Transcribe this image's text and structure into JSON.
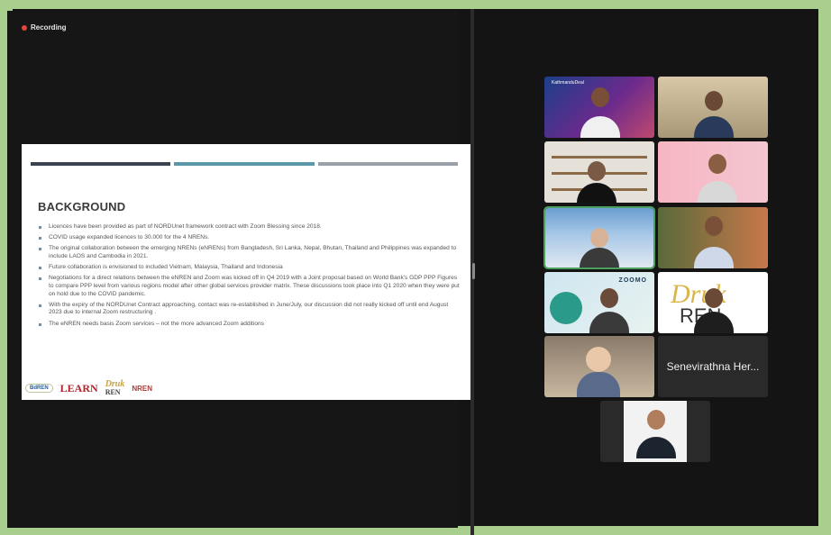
{
  "recording": {
    "label": "Recording"
  },
  "slide": {
    "title": "BACKGROUND",
    "bar_colors": [
      "#3b4350",
      "#5a98a8",
      "#9aa0a8"
    ],
    "bullets": [
      "Licences have been provided as part of NORDUnet framework contract with Zoom Blessing since 2018.",
      "COVID usage expanded licences to 30.000 for the 4 NRENs.",
      "The original collaboration between the emerging NRENs (eNRENs) from Bangladesh, Sri Lanka, Nepal, Bhutan, Thailand and Philippines was expanded to include LAOS and Cambodia in 2021.",
      "Future collaboration is envisioned to included Vietnam, Malaysia, Thailand and Indonesia",
      "Negotiations for a direct relations between the eNREN and Zoom was kicked off in Q4 2019 with a Joint proposal based on World Bank's GDP PPP Figures to compare PPP level from various regions model after other global services provider matrix. These discussions took place into Q1 2020 when they were put on hold due to the COVID pandemic.",
      "With the expiry of the NORDUnet Contract approaching, contact was re-established in June/July, our discussion did not really kicked off until end August 2023 due to internal Zoom restructuring .",
      "The eNREN needs basis Zoom services – not the more advanced Zoom additions"
    ],
    "logos": {
      "bdren": "BdREN",
      "learn": "LEARN",
      "dren_top": "Druk",
      "dren_bottom": "REN",
      "nren": "NREN"
    }
  },
  "participants": {
    "name_tile": "Senevirathna Her...",
    "zoom_banner": "ZOOMO",
    "kathmandu_label": "KathmanduDeal"
  }
}
